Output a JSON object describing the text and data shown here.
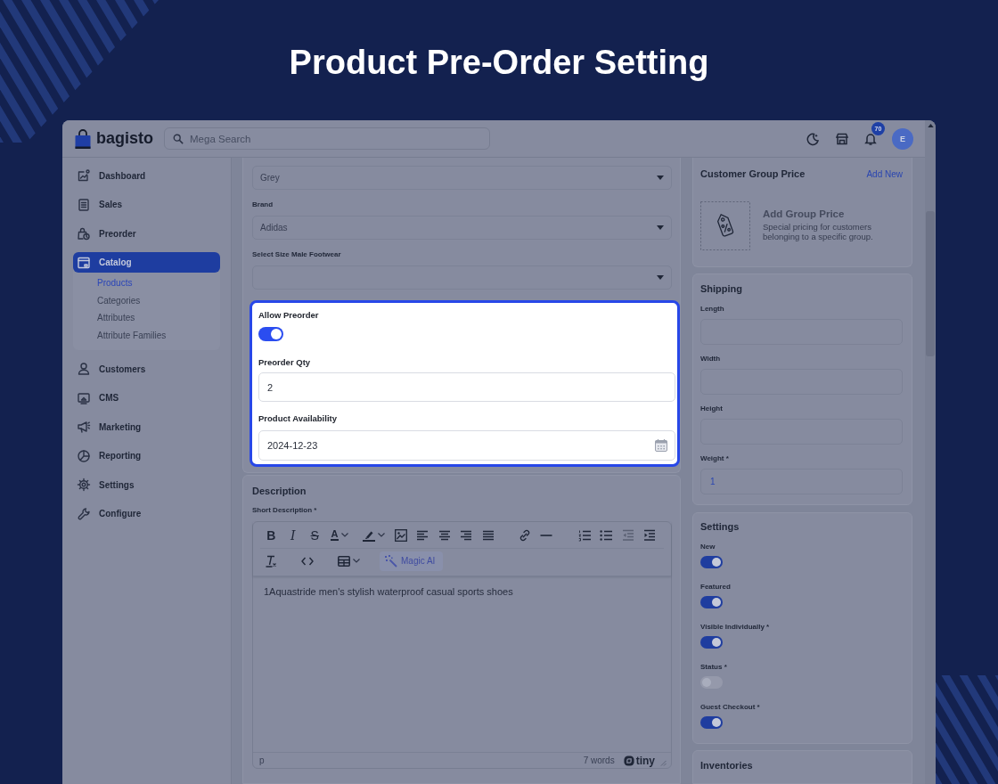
{
  "title": "Product Pre-Order Setting",
  "header": {
    "logo": "bagisto",
    "search": {
      "placeholder": "Mega Search"
    },
    "notification_count": "70",
    "avatar_initial": "E"
  },
  "sidebar": {
    "items": [
      {
        "label": "Dashboard",
        "selected": false
      },
      {
        "label": "Sales",
        "selected": false
      },
      {
        "label": "Preorder",
        "selected": false
      },
      {
        "label": "Catalog",
        "selected": true,
        "children": [
          {
            "label": "Products",
            "selected": true
          },
          {
            "label": "Categories",
            "selected": false
          },
          {
            "label": "Attributes",
            "selected": false
          },
          {
            "label": "Attribute Families",
            "selected": false
          }
        ]
      },
      {
        "label": "Customers",
        "selected": false
      },
      {
        "label": "CMS",
        "selected": false
      },
      {
        "label": "Marketing",
        "selected": false
      },
      {
        "label": "Reporting",
        "selected": false
      },
      {
        "label": "Settings",
        "selected": false
      },
      {
        "label": "Configure",
        "selected": false
      }
    ]
  },
  "attributes": {
    "fields": [
      {
        "value": "Grey"
      },
      {
        "label": "Brand",
        "value": "Adidas"
      },
      {
        "label": "Select Size Male Footwear"
      }
    ]
  },
  "preorder": {
    "allow": {
      "label": "Allow Preorder",
      "on": true
    },
    "qty": {
      "label": "Preorder Qty",
      "value": "2"
    },
    "availability": {
      "label": "Product Availability",
      "value": "2024-12-23"
    }
  },
  "description": {
    "title": "Description",
    "short_description": {
      "label": "Short Description *",
      "toolbar": {
        "bold": "B",
        "italic": "I",
        "strikethrough": "S",
        "text_color": "A",
        "magic_ai": "Magic AI",
        "outdent_disabled": true
      },
      "content": "1Aquastride men's stylish waterproof casual sports shoes",
      "element_path": "p",
      "word_count": "7 words",
      "brand": "tiny"
    }
  },
  "group_price": {
    "title": "Customer Group Price",
    "action": "Add New",
    "empty_title": "Add Group Price",
    "empty_text": "Special pricing for customers belonging to a specific group."
  },
  "shipping": {
    "title": "Shipping",
    "fields": [
      {
        "label": "Length"
      },
      {
        "label": "Width"
      },
      {
        "label": "Height"
      },
      {
        "label": "Weight *",
        "value": "1"
      }
    ]
  },
  "settings": {
    "title": "Settings",
    "toggles": [
      {
        "label": "New",
        "on": true
      },
      {
        "label": "Featured",
        "on": true
      },
      {
        "label": "Visible Individually *",
        "on": true
      },
      {
        "label": "Status *",
        "on": false
      },
      {
        "label": "Guest Checkout *",
        "on": true
      }
    ]
  },
  "inventories": {
    "title": "Inventories"
  }
}
